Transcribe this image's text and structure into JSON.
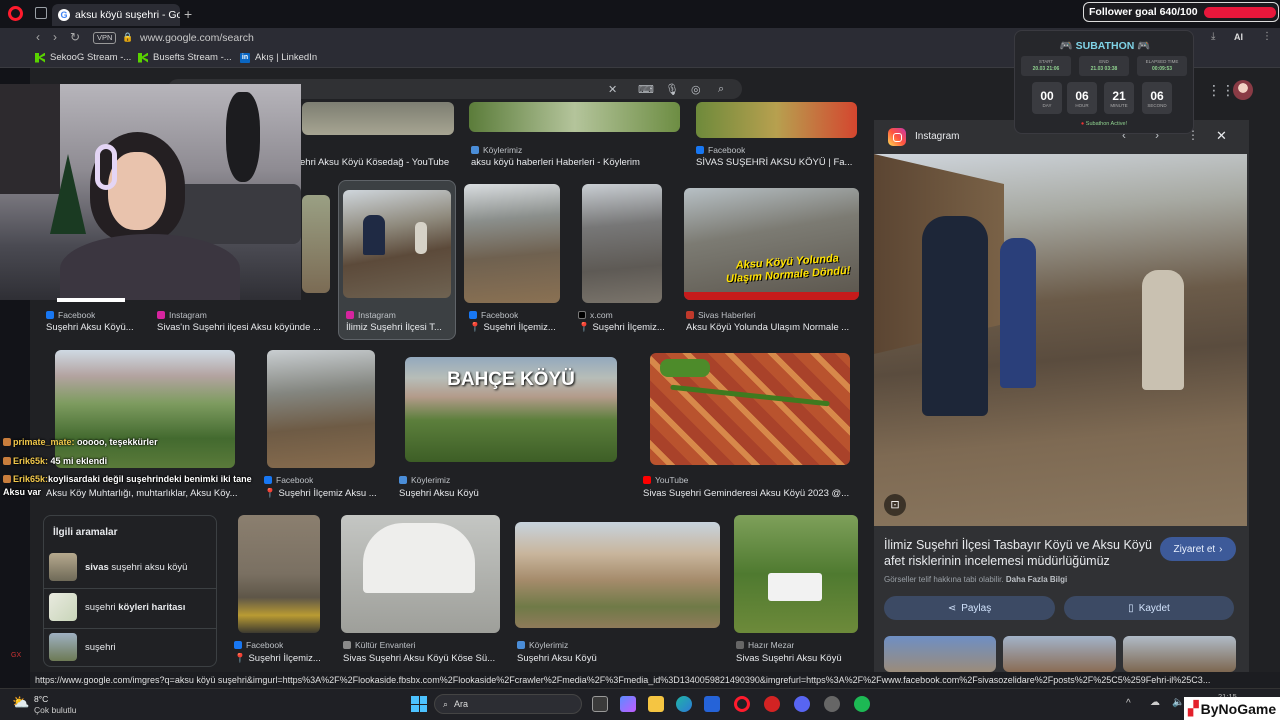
{
  "browser": {
    "tab_title": "aksu köyü suşehri - Google",
    "vpn_label": "VPN",
    "url": "www.google.com/search",
    "bookmarks": [
      "SekooG Stream -...",
      "Busefts Stream -...",
      "Akış | LinkedIn"
    ],
    "ai_label": "AI"
  },
  "overlay": {
    "follower_goal": "Follower goal 640/100",
    "subathon_title": "SUBATHON",
    "start_label": "START",
    "start_value": "20.03 21:06",
    "end_label": "END",
    "end_value": "21.03 03:38",
    "elapsed_label": "ELAPSED TIME",
    "elapsed_value": "00:09:53",
    "countdown": [
      {
        "num": "00",
        "label": "DAY"
      },
      {
        "num": "06",
        "label": "HOUR"
      },
      {
        "num": "21",
        "label": "MINUTE"
      },
      {
        "num": "06",
        "label": "SECOND"
      }
    ],
    "subathon_status": "Subathon Active!"
  },
  "chat": [
    {
      "user": "primate_mate:",
      "msg": "ooooo, teşekkürler"
    },
    {
      "user": "Erik65k:",
      "msg": "45 mi eklendi"
    },
    {
      "user": "Erik65k:",
      "msg": "koylisardaki değil suşehrindeki benimki iki tane"
    },
    {
      "user": "",
      "msg": "Aksu var"
    }
  ],
  "results": {
    "row0": [
      {
        "source": "",
        "title": "ehri Aksu Köyü Kösedağ - YouTube"
      },
      {
        "source": "Köylerimiz",
        "title": "aksu köyü haberleri Haberleri - Köylerim"
      },
      {
        "source": "Facebook",
        "title": "SİVAS SUŞEHRİ AKSU KÖYÜ | Fa..."
      }
    ],
    "row1": [
      {
        "source": "Facebook",
        "title": "Suşehri Aksu Köyü..."
      },
      {
        "source": "Instagram",
        "title": "Sivas'ın Suşehri ilçesi Aksu köyünde ..."
      },
      {
        "source": "Instagram",
        "title": "İlimiz Suşehri İlçesi T..."
      },
      {
        "source": "Facebook",
        "title": "📍 Suşehri İlçemiz..."
      },
      {
        "source": "x.com",
        "title": "📍 Suşehri İlçemiz..."
      },
      {
        "source": "Sivas Haberleri",
        "title": "Aksu Köyü Yolunda Ulaşım Normale ..."
      }
    ],
    "row1_overlay_text": "Aksu Köyü Yolunda Ulaşım Normale Döndü!",
    "row2": [
      {
        "source": "",
        "title": "Aksu Köy Muhtarlığı, muhtarlıklar, Aksu Köy..."
      },
      {
        "source": "Facebook",
        "title": "📍 Suşehri İlçemiz Aksu ..."
      },
      {
        "source": "Köylerimiz",
        "title": "Suşehri Aksu Köyü"
      },
      {
        "source": "YouTube",
        "title": "Sivas Suşehri Geminderesi Aksu Köyü 2023 @..."
      }
    ],
    "row2_overlay_text": "BAHÇE KÖYÜ",
    "row3": [
      {
        "source": "Facebook",
        "title": "📍 Suşehri İlçemiz..."
      },
      {
        "source": "Kültür Envanteri",
        "title": "Sivas Suşehri Aksu Köyü Köse Sü..."
      },
      {
        "source": "Köylerimiz",
        "title": "Suşehri Aksu Köyü"
      },
      {
        "source": "Hazır Mezar",
        "title": "Sivas Suşehri Aksu Köyü"
      }
    ]
  },
  "related": {
    "heading": "İlgili aramalar",
    "items": [
      {
        "bold": "sivas",
        "rest": " suşehri aksu köyü"
      },
      {
        "bold": "",
        "rest": "suşehri ",
        "bold2": "köyleri haritası"
      },
      {
        "bold": "",
        "rest": "suşehri"
      }
    ]
  },
  "preview": {
    "source": "Instagram",
    "title": "İlimiz Suşehri İlçesi Tasbayır Köyü ve Aksu Köyü afet risklerinin incelemesi müdürlüğümüz teknik...",
    "copyright": "Görseller telif hakkına tabi olabilir.",
    "more_info": "Daha Fazla Bilgi",
    "visit": "Ziyaret et",
    "share": "Paylaş",
    "save": "Kaydet"
  },
  "statusbar_url": "https://www.google.com/imgres?q=aksu köyü suşehri&imgurl=https%3A%2F%2Flookaside.fbsbx.com%2Flookaside%2Fcrawler%2Fmedia%2F%3Fmedia_id%3D1340059821490390&imgrefurl=https%3A%2F%2Fwww.facebook.com%2Fsivasozelidare%2Fposts%2F%25C5%259Fehri-il%25C3...",
  "taskbar": {
    "temp": "8°C",
    "weather": "Çok bulutlu",
    "search_placeholder": "Ara",
    "time": "21:15",
    "brand": "ByNoGame"
  }
}
